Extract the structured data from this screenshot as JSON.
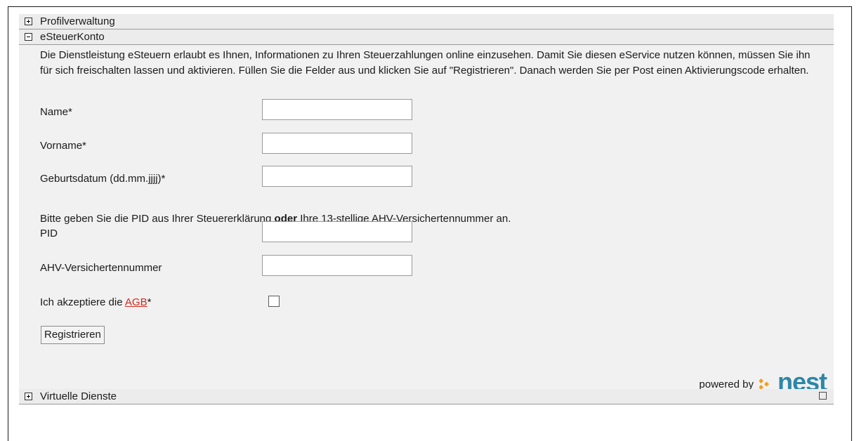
{
  "sections": {
    "profile": {
      "title": "Profilverwaltung",
      "state": "collapsed"
    },
    "steuer": {
      "title": "eSteuerKonto",
      "state": "expanded",
      "intro": "Die Dienstleistung eSteuern erlaubt es Ihnen, Informationen zu Ihren Steuerzahlungen online einzusehen. Damit Sie diesen eService nutzen können, müssen Sie ihn für sich freischalten lassen und aktivieren. Füllen Sie die Felder aus und klicken Sie auf \"Registrieren\". Danach werden Sie per Post einen Aktivierungscode erhalten.",
      "fields": {
        "name": {
          "label": "Name*",
          "value": ""
        },
        "vorname": {
          "label": "Vorname*",
          "value": ""
        },
        "geburtsdatum": {
          "label": "Geburtsdatum (dd.mm.jjjj)*",
          "value": ""
        },
        "pid": {
          "label": "PID",
          "value": ""
        },
        "ahv": {
          "label": "AHV-Versichertennummer",
          "value": ""
        }
      },
      "note": {
        "part1": "Bitte geben Sie die PID aus Ihrer Steuererklärung ",
        "bold": "oder",
        "part2": " Ihre 13-stellige AHV-Versichertennummer an."
      },
      "agb": {
        "prefix": "Ich akzeptiere die ",
        "link": "AGB",
        "suffix": "*",
        "checked": false
      },
      "submit_label": "Registrieren",
      "powered": {
        "text": "powered by",
        "brand": "nest"
      }
    },
    "virtual": {
      "title": "Virtuelle Dienste",
      "state": "collapsed"
    }
  },
  "icons": {
    "expand": "plus-box-icon",
    "collapse": "minus-box-icon",
    "popout": "external-window-icon",
    "brand_mark": "nest-chevron-logo"
  },
  "colors": {
    "link": "#cc2b1d",
    "brand": "#2d86a8",
    "brand_accent": "#f0a020",
    "header_bg": "#ececec"
  }
}
